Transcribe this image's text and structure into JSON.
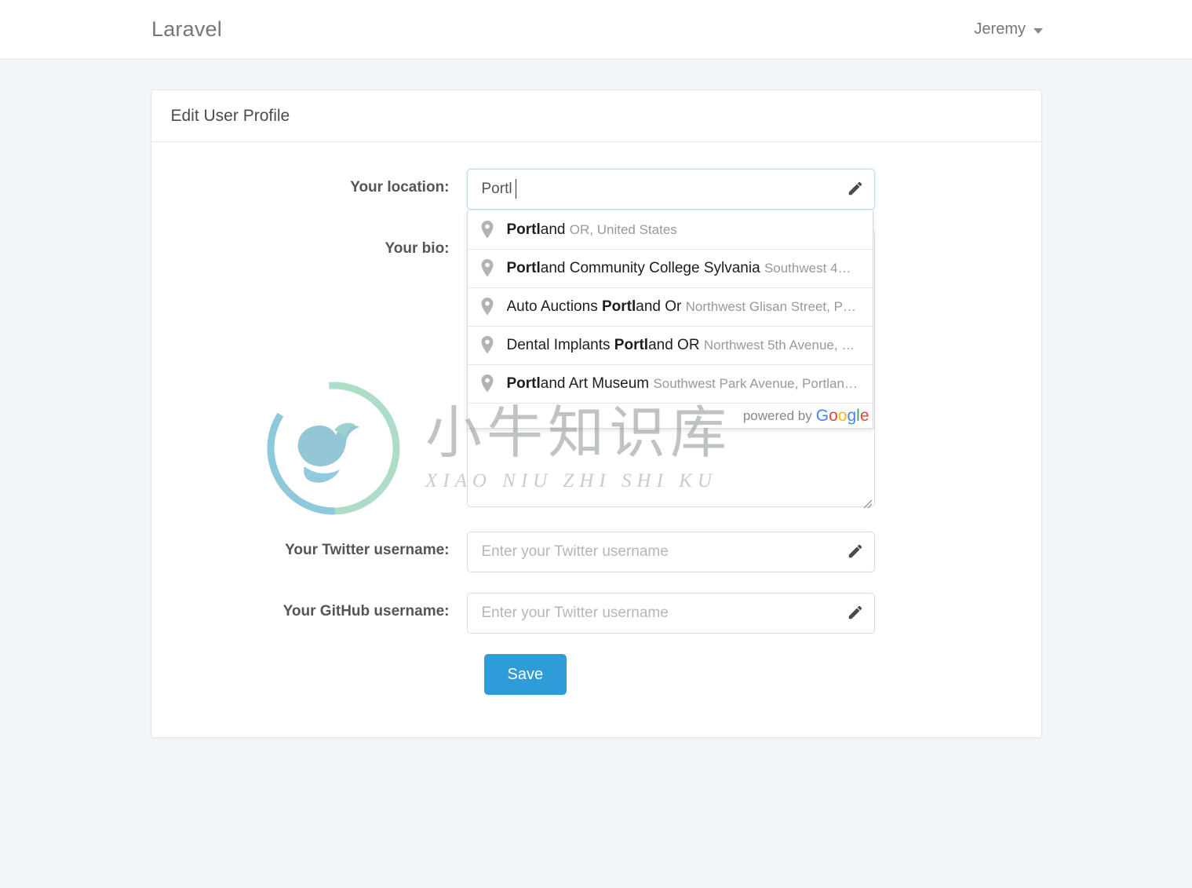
{
  "navbar": {
    "brand": "Laravel",
    "user_name": "Jeremy",
    "caret_icon": "chevron-down-icon"
  },
  "card": {
    "header_title": "Edit User Profile"
  },
  "form": {
    "location": {
      "label": "Your location:",
      "value": "Portl",
      "placeholder": "",
      "icon": "pencil-icon",
      "focused": true
    },
    "bio": {
      "label": "Your bio:",
      "value": "",
      "placeholder": "",
      "icon": "resize-grip-icon"
    },
    "twitter": {
      "label": "Your Twitter username:",
      "value": "",
      "placeholder": "Enter your Twitter username",
      "icon": "pencil-icon"
    },
    "github": {
      "label": "Your GitHub username:",
      "value": "",
      "placeholder": "Enter your Twitter username",
      "icon": "pencil-icon"
    },
    "save_label": "Save"
  },
  "autocomplete": {
    "visible": true,
    "pin_icon": "map-pin-icon",
    "items": [
      {
        "matched": "Portl",
        "main_rest": "and",
        "secondary": "OR, United States",
        "prefix": ""
      },
      {
        "matched": "Portl",
        "main_rest": "and Community College Sylvania",
        "secondary": "Southwest 4…",
        "prefix": ""
      },
      {
        "matched": "Portl",
        "main_rest": "and Or",
        "secondary": "Northwest Glisan Street, P…",
        "prefix": "Auto Auctions "
      },
      {
        "matched": "Portl",
        "main_rest": "and OR",
        "secondary": "Northwest 5th Avenue, …",
        "prefix": "Dental Implants "
      },
      {
        "matched": "Portl",
        "main_rest": "and Art Museum",
        "secondary": "Southwest Park Avenue, Portlan…",
        "prefix": ""
      }
    ],
    "powered_by": "powered by",
    "google_letters": [
      "G",
      "o",
      "o",
      "g",
      "l",
      "e"
    ]
  },
  "watermark": {
    "chinese": "小牛知识库",
    "pinyin": "XIAO NIU ZHI SHI KU",
    "logo_icon": "bull-circle-logo-icon"
  },
  "colors": {
    "accent": "#2d9cd8",
    "page_bg": "#f2f6fa",
    "border": "#e3e7eb",
    "label": "#555555",
    "muted": "#999999"
  }
}
